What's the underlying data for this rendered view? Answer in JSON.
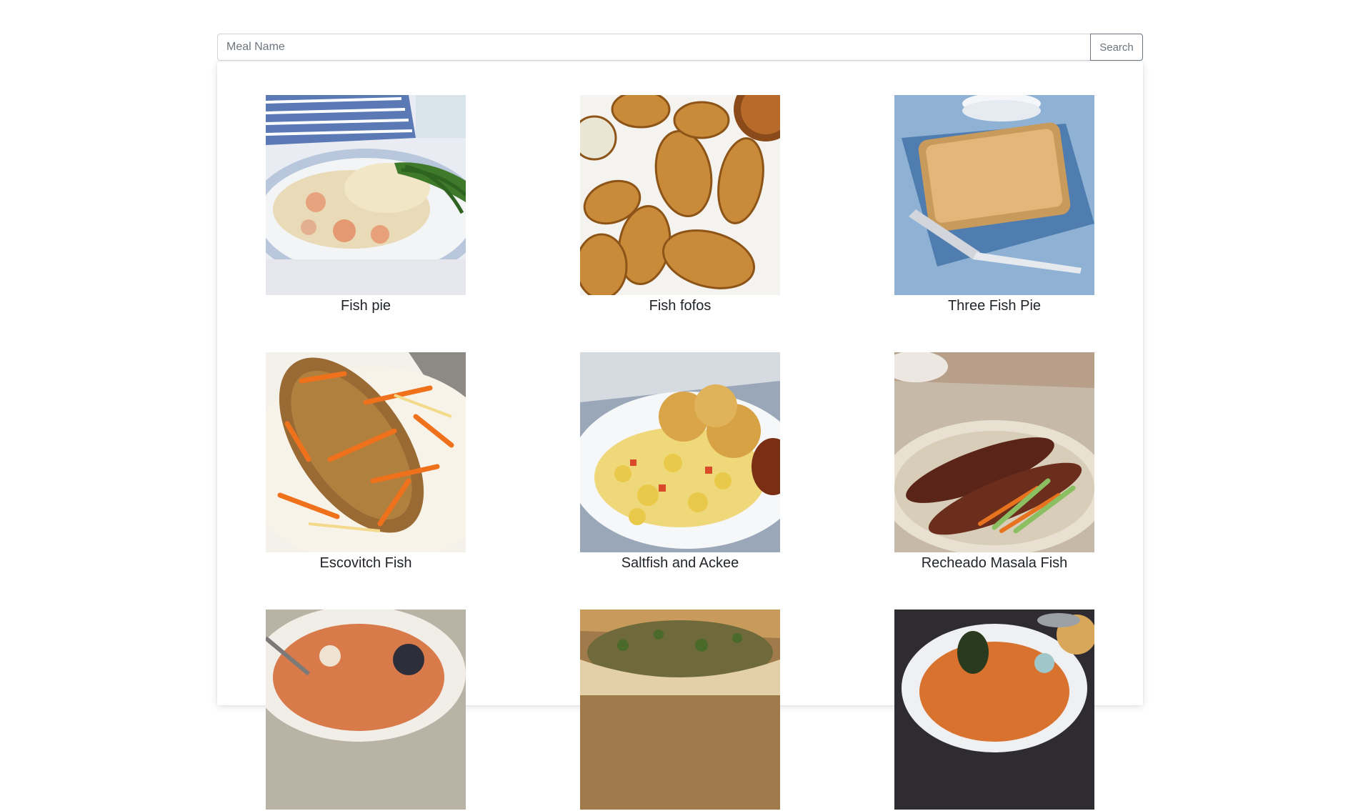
{
  "search": {
    "placeholder": "Meal Name",
    "button_label": "Search"
  },
  "meals": [
    {
      "name": "Fish pie"
    },
    {
      "name": "Fish fofos"
    },
    {
      "name": "Three Fish Pie"
    },
    {
      "name": "Escovitch Fish"
    },
    {
      "name": "Saltfish and Ackee"
    },
    {
      "name": "Recheado Masala Fish"
    },
    {
      "name": ""
    },
    {
      "name": ""
    },
    {
      "name": ""
    }
  ]
}
